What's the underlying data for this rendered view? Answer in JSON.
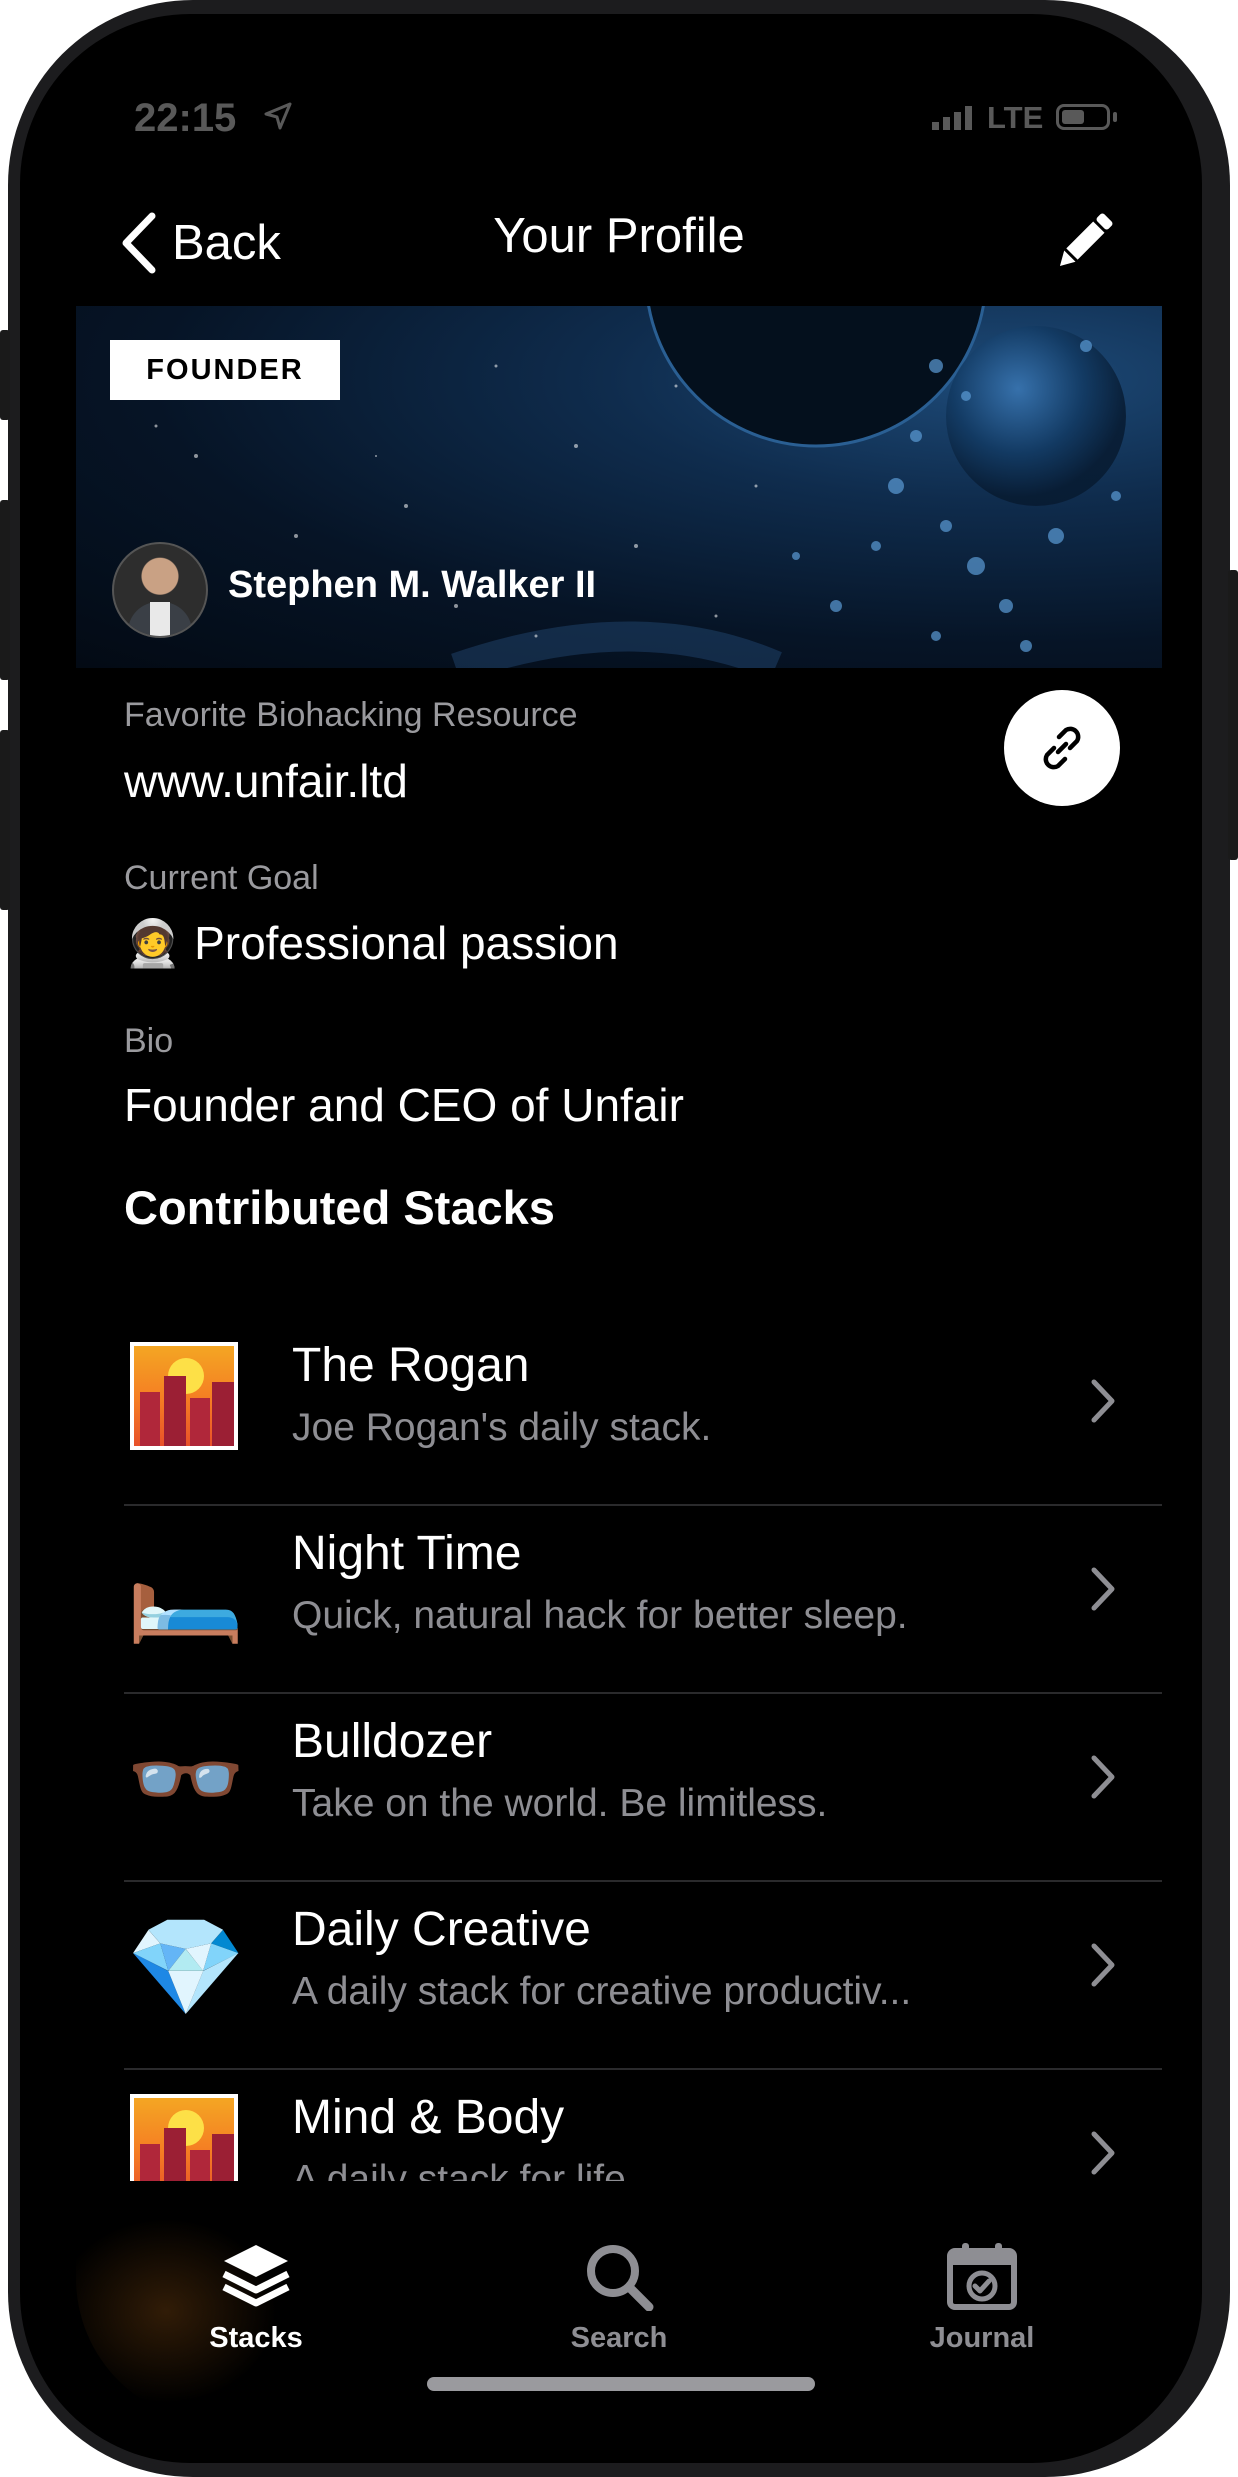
{
  "status_bar": {
    "time": "22:15",
    "network": "LTE"
  },
  "nav": {
    "back_label": "Back",
    "title": "Your Profile"
  },
  "banner": {
    "badge": "FOUNDER",
    "name": "Stephen M. Walker II"
  },
  "fields": {
    "resource_label": "Favorite Biohacking Resource",
    "resource_value": "www.unfair.ltd",
    "goal_label": "Current Goal",
    "goal_emoji": "🧑‍🚀",
    "goal_value": "Professional passion",
    "bio_label": "Bio",
    "bio_value": "Founder and CEO of Unfair"
  },
  "section_title": "Contributed Stacks",
  "stacks": [
    {
      "icon": "city-sunset-icon",
      "title": "The Rogan",
      "description": "Joe Rogan's daily stack."
    },
    {
      "icon": "bed-icon",
      "emoji": "🛏️",
      "title": "Night Time",
      "description": "Quick, natural hack for better sleep."
    },
    {
      "icon": "glasses-icon",
      "emoji": "👓",
      "title": "Bulldozer",
      "description": "Take on the world. Be limitless."
    },
    {
      "icon": "gem-icon",
      "emoji": "💎",
      "title": "Daily Creative",
      "description": "A daily stack for creative productiv..."
    },
    {
      "icon": "city-sunset-icon",
      "title": "Mind & Body",
      "description": "A daily stack for life."
    }
  ],
  "tabs": [
    {
      "label": "Stacks",
      "icon": "layers-icon",
      "active": true
    },
    {
      "label": "Search",
      "icon": "search-icon",
      "active": false
    },
    {
      "label": "Journal",
      "icon": "calendar-check-icon",
      "active": false
    }
  ],
  "colors": {
    "background": "#000000",
    "secondary_text": "#8e8e93",
    "active_tab": "#ffffff"
  }
}
